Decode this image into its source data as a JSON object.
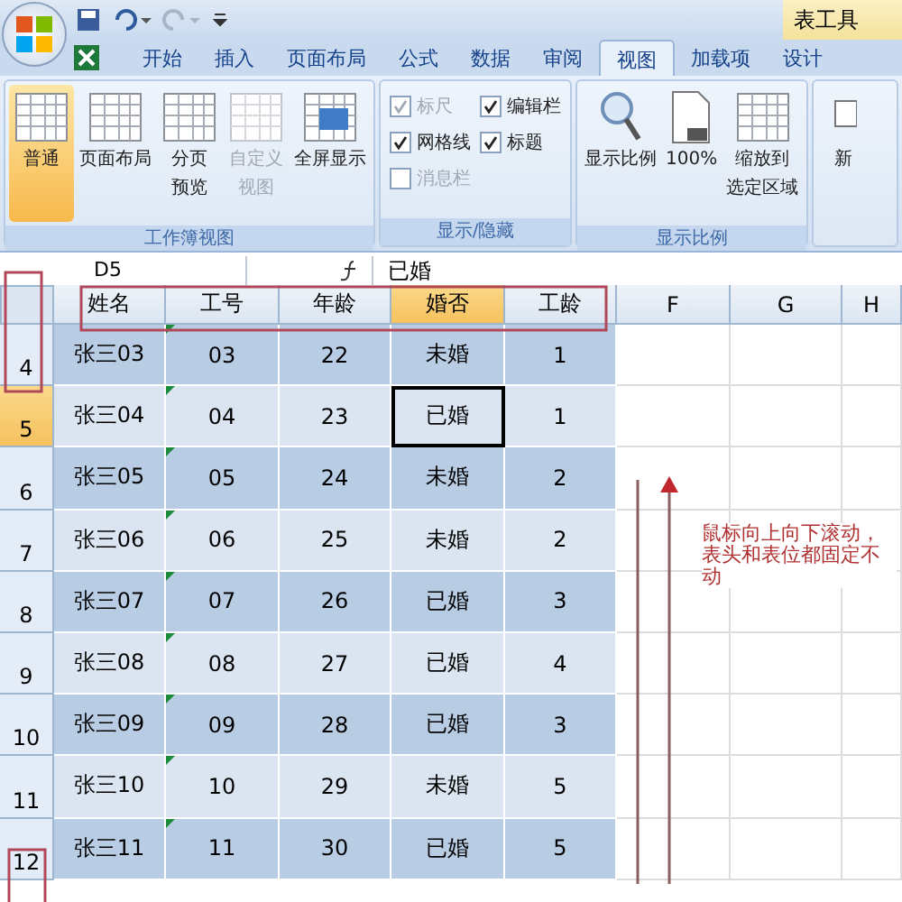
{
  "title_bar": {
    "context_tab": "表工具"
  },
  "tabs": [
    {
      "label": "开始",
      "selected": false
    },
    {
      "label": "插入",
      "selected": false
    },
    {
      "label": "页面布局",
      "selected": false
    },
    {
      "label": "公式",
      "selected": false
    },
    {
      "label": "数据",
      "selected": false
    },
    {
      "label": "审阅",
      "selected": false
    },
    {
      "label": "视图",
      "selected": true
    },
    {
      "label": "加载项",
      "selected": false
    },
    {
      "label": "设计",
      "selected": false
    }
  ],
  "ribbon": {
    "groups": [
      {
        "title": "工作簿视图",
        "kind": "buttons",
        "items": [
          {
            "lines": [
              "普通"
            ],
            "selected": true,
            "disabled": false
          },
          {
            "lines": [
              "页面布局"
            ],
            "selected": false,
            "disabled": false
          },
          {
            "lines": [
              "分页",
              "预览"
            ],
            "selected": false,
            "disabled": false
          },
          {
            "lines": [
              "自定义",
              "视图"
            ],
            "selected": false,
            "disabled": true
          },
          {
            "lines": [
              "全屏显示"
            ],
            "selected": false,
            "disabled": false
          }
        ]
      },
      {
        "title": "显示/隐藏",
        "kind": "checks",
        "items": [
          {
            "label": "标尺",
            "checked": true,
            "disabled": true
          },
          {
            "label": "网格线",
            "checked": true,
            "disabled": false
          },
          {
            "label": "消息栏",
            "checked": false,
            "disabled": true
          },
          {
            "label": "编辑栏",
            "checked": true,
            "disabled": false
          },
          {
            "label": "标题",
            "checked": true,
            "disabled": false
          }
        ]
      },
      {
        "title": "显示比例",
        "kind": "buttons",
        "items": [
          {
            "lines": [
              "显示比例"
            ],
            "selected": false,
            "disabled": false
          },
          {
            "lines": [
              "100%"
            ],
            "selected": false,
            "disabled": false
          },
          {
            "lines": [
              "缩放到",
              "选定区域"
            ],
            "selected": false,
            "disabled": false
          }
        ]
      },
      {
        "kind": "buttons",
        "items": [
          {
            "lines": [
              "新"
            ],
            "selected": false
          }
        ]
      }
    ]
  },
  "formula_bar": {
    "name_box": "D5",
    "value": "已婚"
  },
  "columns": [
    {
      "label": "姓名",
      "selected": false
    },
    {
      "label": "工号",
      "selected": false
    },
    {
      "label": "年龄",
      "selected": false
    },
    {
      "label": "婚否",
      "selected": true
    },
    {
      "label": "工龄",
      "selected": false
    },
    {
      "label": "F",
      "selected": false
    },
    {
      "label": "G",
      "selected": false
    },
    {
      "label": "H",
      "selected": false
    }
  ],
  "rows": [
    {
      "header": "4",
      "selected": false,
      "cells": [
        "张三03",
        "03",
        "22",
        "未婚",
        "1"
      ]
    },
    {
      "header": "5",
      "selected": true,
      "cells": [
        "张三04",
        "04",
        "23",
        "已婚",
        "1"
      ]
    },
    {
      "header": "6",
      "selected": false,
      "cells": [
        "张三05",
        "05",
        "24",
        "未婚",
        "2"
      ]
    },
    {
      "header": "7",
      "selected": false,
      "cells": [
        "张三06",
        "06",
        "25",
        "未婚",
        "2"
      ]
    },
    {
      "header": "8",
      "selected": false,
      "cells": [
        "张三07",
        "07",
        "26",
        "已婚",
        "3"
      ]
    },
    {
      "header": "9",
      "selected": false,
      "cells": [
        "张三08",
        "08",
        "27",
        "已婚",
        "4"
      ]
    },
    {
      "header": "10",
      "selected": false,
      "cells": [
        "张三09",
        "09",
        "28",
        "已婚",
        "3"
      ]
    },
    {
      "header": "11",
      "selected": false,
      "cells": [
        "张三10",
        "10",
        "29",
        "未婚",
        "5"
      ]
    },
    {
      "header": "12",
      "selected": false,
      "cells": [
        "张三11",
        "11",
        "30",
        "已婚",
        "5"
      ]
    }
  ],
  "annotation": {
    "text": "鼠标向上向下滚动，表头和表位都固定不动"
  }
}
